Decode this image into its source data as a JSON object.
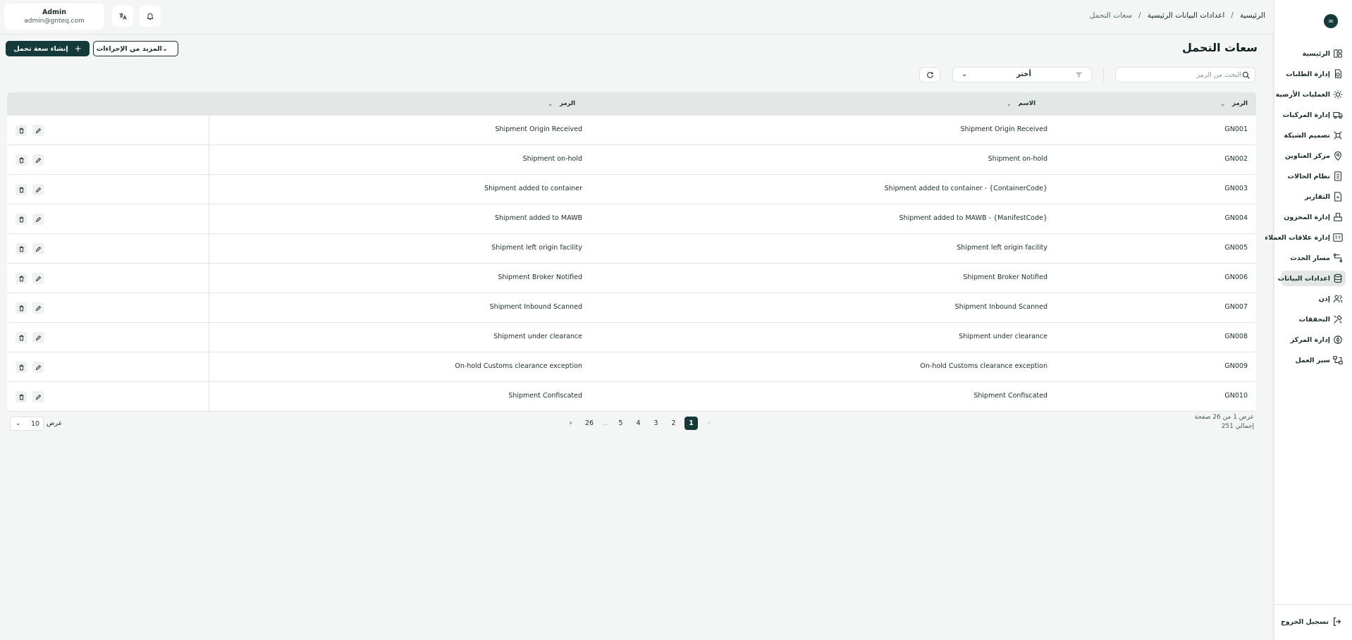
{
  "sidebar": {
    "items": [
      {
        "label": "الرئيسية",
        "icon": "layout-icon"
      },
      {
        "label": "إدارة الطلبات",
        "icon": "orders-icon"
      },
      {
        "label": "العمليات الأرضية",
        "icon": "ground-ops-icon"
      },
      {
        "label": "إدارة المركبات",
        "icon": "truck-icon"
      },
      {
        "label": "تصميم الشبكة",
        "icon": "network-icon"
      },
      {
        "label": "مركز العناوين",
        "icon": "location-icon"
      },
      {
        "label": "نظام الحالات",
        "icon": "status-icon"
      },
      {
        "label": "التقارير",
        "icon": "report-icon"
      },
      {
        "label": "إدارة المخزون",
        "icon": "inventory-icon"
      },
      {
        "label": "إدارة علاقات العملاء",
        "icon": "crm-icon"
      },
      {
        "label": "مسار الحدث",
        "icon": "route-icon"
      },
      {
        "label": "اعدادات البيانات",
        "icon": "database-icon"
      },
      {
        "label": "إذن",
        "icon": "users-icon"
      },
      {
        "label": "التحققات",
        "icon": "tools-icon"
      },
      {
        "label": "إدارة المركز",
        "icon": "hub-icon"
      },
      {
        "label": "سير العمل",
        "icon": "workflow-icon"
      }
    ],
    "logout_label": "تسجيل الخروج"
  },
  "header": {
    "user_name": "Admin",
    "user_email": "admin@gnteq.com",
    "breadcrumb": [
      "الرئيسية",
      "اعدادات البيانات الرئيسية",
      "سعات التحمل"
    ],
    "separator": "/"
  },
  "page": {
    "title": "سعات التحمل",
    "create_label": "إنشاء سعة تحمل",
    "more_actions_label": "المزيد من الإجراءات",
    "search_placeholder": "البحث من الرمز",
    "filter_value": "أختر"
  },
  "table": {
    "columns": [
      "الرمز",
      "الاسم",
      "الرمز"
    ],
    "rows": [
      {
        "code": "GN001",
        "name": "Shipment Origin Received",
        "description": "Shipment Origin Received"
      },
      {
        "code": "GN002",
        "name": "Shipment on-hold",
        "description": "Shipment on-hold"
      },
      {
        "code": "GN003",
        "name": "Shipment added to container - {ContainerCode}",
        "description": "Shipment added to container"
      },
      {
        "code": "GN004",
        "name": "Shipment added to MAWB - {ManifestCode}",
        "description": "Shipment added to MAWB"
      },
      {
        "code": "GN005",
        "name": "Shipment left origin facility",
        "description": "Shipment left origin facility"
      },
      {
        "code": "GN006",
        "name": "Shipment Broker Notified",
        "description": "Shipment Broker Notified"
      },
      {
        "code": "GN007",
        "name": "Shipment Inbound Scanned",
        "description": "Shipment Inbound Scanned"
      },
      {
        "code": "GN008",
        "name": "Shipment under clearance",
        "description": "Shipment under clearance"
      },
      {
        "code": "GN009",
        "name": "On-hold Customs clearance exception",
        "description": "On-hold Customs clearance exception"
      },
      {
        "code": "GN010",
        "name": "Shipment Confiscated",
        "description": "Shipment Confiscated"
      }
    ]
  },
  "pagination": {
    "info": "عرض 1 من 26 صفحة",
    "total": "إجمالي 251",
    "pages": [
      "1",
      "2",
      "3",
      "4",
      "5",
      "...",
      "26"
    ],
    "current": "1",
    "page_size": "10",
    "page_size_label": "عرض"
  },
  "colors": {
    "primary": "#153a3a",
    "header_row": "#e3e7e6",
    "background": "#f4f6f5"
  }
}
